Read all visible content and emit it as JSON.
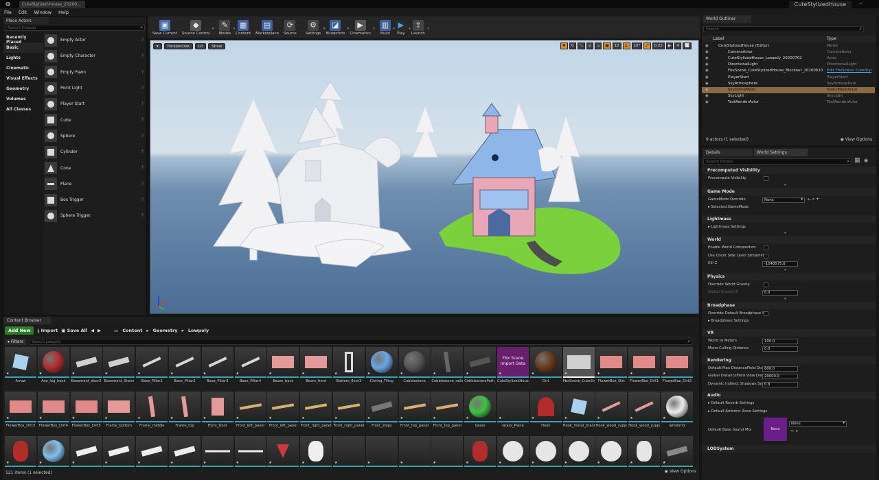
{
  "window": {
    "doc_tab": "CuteStylized-house_20200...",
    "project": "CuteStylizedHouse"
  },
  "menu": [
    "File",
    "Edit",
    "Window",
    "Help"
  ],
  "place_actors": {
    "tab": "Place Actors",
    "search_placeholder": "Search Classes",
    "categories": [
      "Recently Placed",
      "Basic",
      "Lights",
      "Cinematic",
      "Visual Effects",
      "Geometry",
      "Volumes",
      "All Classes"
    ],
    "selected_category": "Basic",
    "actors": [
      {
        "label": "Empty Actor",
        "icon": "sphere"
      },
      {
        "label": "Empty Character",
        "icon": "character"
      },
      {
        "label": "Empty Pawn",
        "icon": "pawn"
      },
      {
        "label": "Point Light",
        "icon": "light"
      },
      {
        "label": "Player Start",
        "icon": "player"
      },
      {
        "label": "Cube",
        "icon": "cube"
      },
      {
        "label": "Sphere",
        "icon": "sphere"
      },
      {
        "label": "Cylinder",
        "icon": "cylinder"
      },
      {
        "label": "Cone",
        "icon": "cone"
      },
      {
        "label": "Plane",
        "icon": "plane"
      },
      {
        "label": "Box Trigger",
        "icon": "box"
      },
      {
        "label": "Sphere Trigger",
        "icon": "sphere"
      }
    ]
  },
  "toolbar": [
    {
      "label": "Save Current",
      "icon": "save-icon",
      "color": "#4a6fb0",
      "glyph": "▣"
    },
    {
      "label": "Source Control",
      "icon": "source-control-icon",
      "color": "#555",
      "glyph": "◆"
    },
    {
      "label": "Modes",
      "icon": "modes-icon",
      "color": "#444",
      "glyph": "✎"
    },
    {
      "label": "Content",
      "icon": "content-icon",
      "color": "#3d5f9a",
      "glyph": "▦"
    },
    {
      "label": "Marketplace",
      "icon": "marketplace-icon",
      "color": "#3d5f9a",
      "glyph": "▤"
    },
    {
      "label": "Source",
      "icon": "source-icon",
      "color": "#444",
      "glyph": "⟳"
    },
    {
      "label": "Settings",
      "icon": "settings-icon",
      "color": "#444",
      "glyph": "⚙"
    },
    {
      "label": "Blueprints",
      "icon": "blueprints-icon",
      "color": "#3d5f9a",
      "glyph": "◪"
    },
    {
      "label": "Cinematics",
      "icon": "cinematics-icon",
      "color": "#555",
      "glyph": "▶"
    },
    {
      "label": "Build",
      "icon": "build-icon",
      "color": "#3d5f9a",
      "glyph": "▥"
    },
    {
      "label": "Play",
      "icon": "play-icon",
      "color": "#2a2a2a",
      "glyph": "▶"
    },
    {
      "label": "Launch",
      "icon": "launch-icon",
      "color": "#444",
      "glyph": "⇪"
    }
  ],
  "viewport": {
    "buttons": [
      "Perspective",
      "Lit",
      "Show"
    ],
    "right_values": [
      "10",
      "10°",
      "0.25",
      "4"
    ]
  },
  "content_browser": {
    "tab": "Content Browser",
    "add_new": "Add New",
    "import": "Import",
    "save_all": "Save All",
    "path": [
      "Content",
      "Geometry",
      "Lowpoly"
    ],
    "filters": "Filters",
    "search_placeholder": "Search Lowpoly",
    "status": "121 items (1 selected)",
    "view_options": "View Options",
    "assets": [
      {
        "label": "Arrow",
        "kind": "box",
        "color": "#a9d2ee"
      },
      {
        "label": "Axe_log_hook",
        "kind": "ball",
        "color": "#b22c2c"
      },
      {
        "label": "Basement_door2",
        "kind": "flat",
        "color": "#d0d0d0"
      },
      {
        "label": "Basement_Stairs",
        "kind": "flat",
        "color": "#d0d0d0"
      },
      {
        "label": "Base_Pillar1",
        "kind": "bar",
        "color": "#d6d6d6"
      },
      {
        "label": "Base_Pillar2",
        "kind": "bar",
        "color": "#d6d6d6"
      },
      {
        "label": "Base_Pillar3",
        "kind": "bar",
        "color": "#d6d6d6"
      },
      {
        "label": "Base_Pillar4",
        "kind": "bar",
        "color": "#d6d6d6"
      },
      {
        "label": "Beam_back",
        "kind": "block",
        "color": "#e59a9a"
      },
      {
        "label": "Beam_front",
        "kind": "block",
        "color": "#e59a9a"
      },
      {
        "label": "Bottom_floor3",
        "kind": "frame",
        "color": "#dcdcdc"
      },
      {
        "label": "Cieling_Tiling",
        "kind": "ball",
        "color": "#6aa6e6"
      },
      {
        "label": "Cobblestone",
        "kind": "ball",
        "color": "#555555"
      },
      {
        "label": "Cobblestone_railing",
        "kind": "post",
        "color": "#666666"
      },
      {
        "label": "CobblestonePath_TEMP",
        "kind": "flat",
        "color": "#555555"
      },
      {
        "label": "CuteStylizedHouse_Lowpoly_20200702",
        "kind": "purple",
        "color": "#6a1e6e",
        "text": "Fbx Scene Import Data"
      },
      {
        "label": "Dirt",
        "kind": "ball",
        "color": "#6b3a1c"
      },
      {
        "label": "FbxScene_CuteStylizedHouse_Lowpoly",
        "kind": "selected",
        "color": "#d0d0d0"
      },
      {
        "label": "FlowerBox_Dirt",
        "kind": "block",
        "color": "#e08a8a"
      },
      {
        "label": "FlowerBox_Dirt1",
        "kind": "block",
        "color": "#e08a8a"
      },
      {
        "label": "FlowerBox_Dirt2",
        "kind": "block",
        "color": "#e08a8a"
      },
      {
        "label": "FlowerBox_Dirt3",
        "kind": "block",
        "color": "#e08a8a"
      },
      {
        "label": "FlowerBox_Dirt4",
        "kind": "block",
        "color": "#e08a8a"
      },
      {
        "label": "FlowerBox_Dirt5",
        "kind": "block",
        "color": "#e08a8a"
      },
      {
        "label": "Frame_bottom",
        "kind": "block",
        "color": "#e59a9a"
      },
      {
        "label": "Frame_middle",
        "kind": "post",
        "color": "#e59a9a"
      },
      {
        "label": "Frame_top",
        "kind": "post",
        "color": "#e59a9a"
      },
      {
        "label": "Front_Door",
        "kind": "door",
        "color": "#e59a9a"
      },
      {
        "label": "Front_left_panel",
        "kind": "plank",
        "color": "#d8b070"
      },
      {
        "label": "Front_left_panel",
        "kind": "plank",
        "color": "#d8b070"
      },
      {
        "label": "Front_right_panel",
        "kind": "plank",
        "color": "#d8b070"
      },
      {
        "label": "Front_right_panel",
        "kind": "plank",
        "color": "#d8b070"
      },
      {
        "label": "Front_steps",
        "kind": "flat",
        "color": "#777777"
      },
      {
        "label": "Front_top_panel",
        "kind": "plank",
        "color": "#d8b070"
      },
      {
        "label": "Front_top_panel",
        "kind": "plank",
        "color": "#d8b070"
      },
      {
        "label": "Grass",
        "kind": "ball",
        "color": "#3fc23f"
      },
      {
        "label": "Grass_Plane",
        "kind": "empty",
        "color": "#999999"
      },
      {
        "label": "Hook",
        "kind": "hook",
        "color": "#b22c2c"
      },
      {
        "label": "Hook_metal_bracket",
        "kind": "box",
        "color": "#a9d2ee"
      },
      {
        "label": "Hook_wood_support",
        "kind": "bar",
        "color": "#e59a9a"
      },
      {
        "label": "Hook_wood_support_bottom",
        "kind": "bar",
        "color": "#e59a9a"
      },
      {
        "label": "lambert1",
        "kind": "ball",
        "color": "#eeeeee"
      },
      {
        "label": "",
        "kind": "cyl",
        "color": "#b22c2c"
      },
      {
        "label": "",
        "kind": "ball",
        "color": "#7ec0ee"
      },
      {
        "label": "",
        "kind": "flat",
        "color": "#eeeeee"
      },
      {
        "label": "",
        "kind": "flat",
        "color": "#eeeeee"
      },
      {
        "label": "",
        "kind": "flat",
        "color": "#eeeeee"
      },
      {
        "label": "",
        "kind": "flat",
        "color": "#eeeeee"
      },
      {
        "label": "",
        "kind": "line",
        "color": "#eeeeee"
      },
      {
        "label": "",
        "kind": "line",
        "color": "#eeeeee"
      },
      {
        "label": "",
        "kind": "cone",
        "color": "#d03a3a"
      },
      {
        "label": "",
        "kind": "cyl",
        "color": "#eeeeee"
      },
      {
        "label": "",
        "kind": "empty",
        "color": "#999999"
      },
      {
        "label": "",
        "kind": "empty",
        "color": "#999999"
      },
      {
        "label": "",
        "kind": "empty",
        "color": "#999999"
      },
      {
        "label": "",
        "kind": "empty",
        "color": "#999999"
      },
      {
        "label": "",
        "kind": "cyl",
        "color": "#b22c2c"
      },
      {
        "label": "",
        "kind": "disc",
        "color": "#e6e6e6"
      },
      {
        "label": "",
        "kind": "disc",
        "color": "#e6e6e6"
      },
      {
        "label": "",
        "kind": "disc",
        "color": "#e6e6e6"
      },
      {
        "label": "",
        "kind": "disc",
        "color": "#e6e6e6"
      },
      {
        "label": "",
        "kind": "cyl",
        "color": "#e6e6e6"
      },
      {
        "label": "",
        "kind": "flat",
        "color": "#888888"
      }
    ]
  },
  "outliner": {
    "tab": "World Outliner",
    "search_placeholder": "Search",
    "col_label": "Label",
    "col_type": "Type",
    "rows": [
      {
        "name": "CuteStylizedHouse (Editor)",
        "type": "World",
        "indent": 0
      },
      {
        "name": "CameraActor",
        "type": "CameraActor",
        "indent": 1
      },
      {
        "name": "CuteStylizedHouse_Lowpoly_20200702",
        "type": "Actor",
        "indent": 1
      },
      {
        "name": "DirectionalLight",
        "type": "DirectionalLight",
        "indent": 1
      },
      {
        "name": "FbxScene_CuteStylizedHouse_Blockout_20200610",
        "type": "Edit FbxScene_CuteStyl",
        "indent": 1,
        "link": true
      },
      {
        "name": "PlayerStart",
        "type": "PlayerStart",
        "indent": 1
      },
      {
        "name": "SkyAtmosphere",
        "type": "SkyAtmosphere",
        "indent": 1
      },
      {
        "name": "SkyDomeMesh",
        "type": "StaticMeshActor",
        "indent": 1,
        "selected": true
      },
      {
        "name": "SkyLight",
        "type": "SkyLight",
        "indent": 1
      },
      {
        "name": "TextRenderActor",
        "type": "TextRenderActor",
        "indent": 1
      }
    ],
    "footer": "9 actors (1 selected)",
    "view_options": "View Options"
  },
  "details": {
    "tab_details": "Details",
    "tab_world": "World Settings",
    "search_placeholder": "Search Details",
    "sections": [
      {
        "title": "Precomputed Visibility",
        "props": [
          {
            "label": "Precompute Visibility",
            "ctl": "chk"
          }
        ],
        "more": true
      },
      {
        "title": "Game Mode",
        "props": [
          {
            "label": "GameMode Override",
            "ctl": "dd",
            "value": "None"
          },
          {
            "label": "Selected GameMode",
            "ctl": "none",
            "arrow": true
          }
        ]
      },
      {
        "title": "Lightmass",
        "props": [
          {
            "label": "Lightmass Settings",
            "ctl": "none",
            "arrow": true
          }
        ],
        "more": true
      },
      {
        "title": "World",
        "props": [
          {
            "label": "Enable World Composition",
            "ctl": "chk"
          },
          {
            "label": "Use Client Side Level Streamin",
            "ctl": "chk"
          },
          {
            "label": "Kill Z",
            "ctl": "num",
            "value": "-1048575.0"
          }
        ],
        "more": true
      },
      {
        "title": "Physics",
        "props": [
          {
            "label": "Override World Gravity",
            "ctl": "chk"
          },
          {
            "label": "Global Gravity Z",
            "ctl": "num",
            "value": "0.0",
            "dim": true
          }
        ],
        "more": true
      },
      {
        "title": "Broadphase",
        "props": [
          {
            "label": "Override Default Broadphase S",
            "ctl": "chk"
          },
          {
            "label": "Broadphase Settings",
            "ctl": "none",
            "arrow": true
          }
        ]
      },
      {
        "title": "VR",
        "props": [
          {
            "label": "World to Meters",
            "ctl": "num",
            "value": "100.0"
          },
          {
            "label": "Mono Culling Distance",
            "ctl": "num",
            "value": "0.0"
          }
        ]
      },
      {
        "title": "Rendering",
        "props": [
          {
            "label": "Default Max DistanceField Occ",
            "ctl": "num",
            "value": "600.0"
          },
          {
            "label": "Global DistanceField View Dist",
            "ctl": "num",
            "value": "20000.0"
          },
          {
            "label": "Dynamic Indirect Shadows Self",
            "ctl": "num",
            "value": "0.8"
          }
        ]
      },
      {
        "title": "Audio",
        "props": [
          {
            "label": "Default Reverb Settings",
            "ctl": "none",
            "arrow": true
          },
          {
            "label": "Default Ambient Zone Settings",
            "ctl": "none",
            "arrow": true
          },
          {
            "label": "Default Base Sound Mix",
            "ctl": "sound",
            "value": "None",
            "thumb": "None"
          }
        ]
      },
      {
        "title": "LODSystem",
        "props": []
      }
    ]
  }
}
